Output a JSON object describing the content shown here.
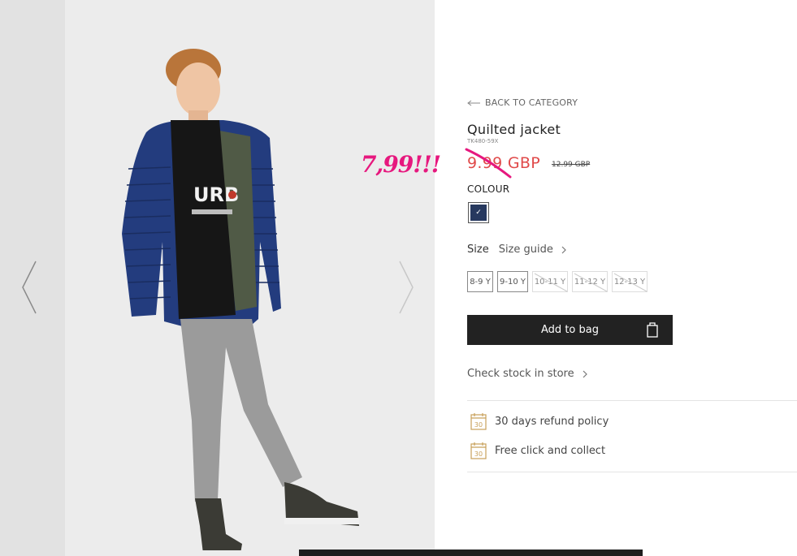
{
  "navigation": {
    "back_label": "BACK TO CATEGORY"
  },
  "product": {
    "title": "Quilted jacket",
    "sku": "TK480-59X",
    "price": "9.99 GBP",
    "old_price": "12.99 GBP",
    "annotation_price": "7,99!!!"
  },
  "colour": {
    "label": "COLOUR",
    "selected_swatch_color": "#27395f"
  },
  "size": {
    "label": "Size",
    "guide_label": "Size guide",
    "options": [
      {
        "label": "8-9 Y",
        "available": true
      },
      {
        "label": "9-10 Y",
        "available": true
      },
      {
        "label": "10-11 Y",
        "available": false
      },
      {
        "label": "11-12 Y",
        "available": false
      },
      {
        "label": "12-13 Y",
        "available": false
      }
    ]
  },
  "actions": {
    "add_to_bag": "Add to bag",
    "check_stock": "Check stock in store"
  },
  "perks": [
    {
      "icon": "calendar-30-icon",
      "text": "30 days refund policy"
    },
    {
      "icon": "calendar-30-icon",
      "text": "Free click and collect"
    }
  ],
  "colors": {
    "price_red": "#e04a4a",
    "annotation_pink": "#e6187e",
    "button_dark": "#222222",
    "perk_icon": "#c8a05a"
  }
}
